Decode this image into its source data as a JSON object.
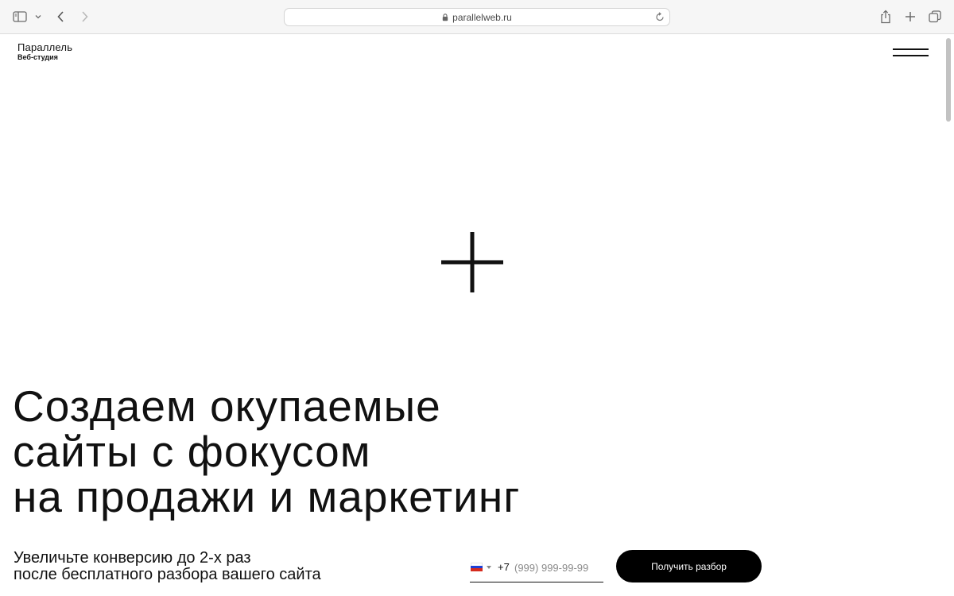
{
  "browser": {
    "url": "parallelweb.ru",
    "icons": {
      "sidebar": "sidebar-icon",
      "dropdown": "chevron-down-icon",
      "back": "chevron-left-icon",
      "forward": "chevron-right-icon",
      "lock": "lock-icon",
      "reload": "reload-icon",
      "share": "share-icon",
      "new_tab": "plus-icon",
      "tabs": "tabs-overview-icon"
    }
  },
  "header": {
    "logo_title": "Параллель",
    "logo_subtitle": "Веб-студия",
    "menu_icon": "hamburger-menu-icon"
  },
  "hero": {
    "decor_icon": "plus-icon",
    "title_lines": [
      "Создаем окупаемые",
      "сайты с фокусом",
      "на продажи и маркетинг"
    ],
    "subtitle_lines": [
      "Увеличьте конверсию до 2-х раз",
      "после бесплатного разбора вашего сайта"
    ]
  },
  "form": {
    "country_flag": "russia-flag-icon",
    "flag_colors": [
      "#ffffff",
      "#1c3fd6",
      "#d52b1e"
    ],
    "phone_code": "+7",
    "phone_placeholder": "(999) 999-99-99",
    "phone_value": "",
    "submit_label": "Получить разбор"
  },
  "colors": {
    "text": "#111111",
    "button_bg": "#000000",
    "button_text": "#ffffff",
    "chrome_bg": "#f6f6f6"
  }
}
